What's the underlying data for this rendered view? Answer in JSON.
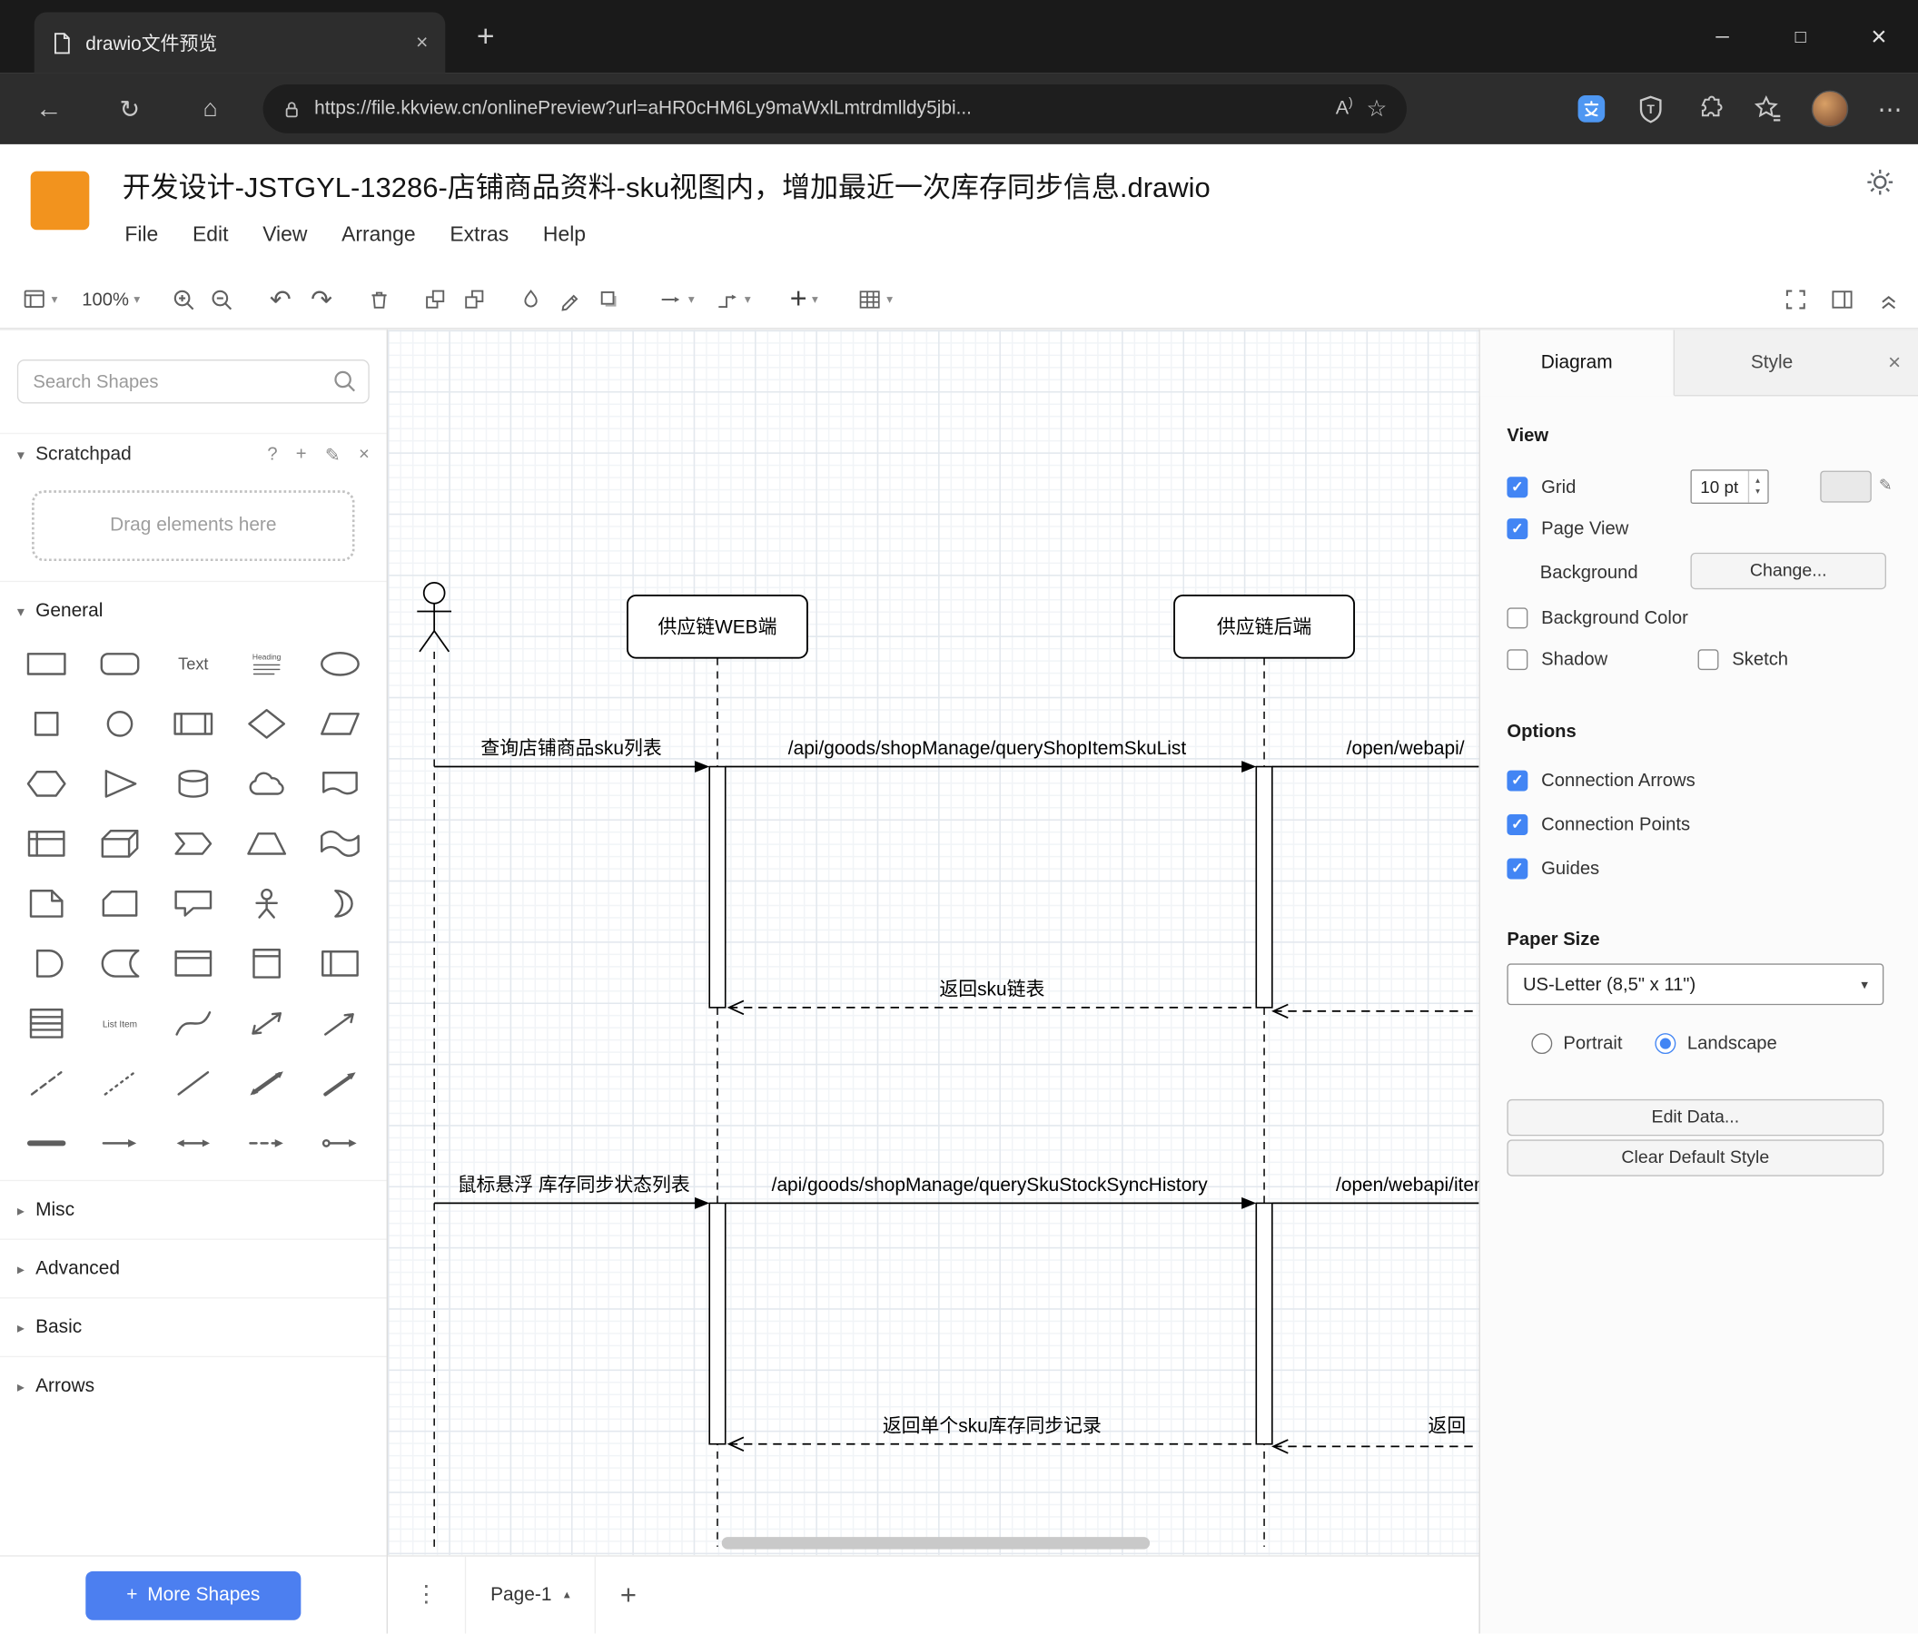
{
  "browser": {
    "tab_title": "drawio文件预览",
    "url": "https://file.kkview.cn/onlinePreview?url=aHR0cHM6Ly9maWxlLmtrdmlldy5jbi..."
  },
  "icons": {
    "back": "←",
    "refresh": "↻",
    "home": "⌂",
    "star": "☆",
    "read_aloud": "A",
    "minimize": "─",
    "maximize": "□",
    "close": "×",
    "new_tab": "+",
    "more_h": "⋯",
    "more_v": "⋮",
    "caret_down": "▾",
    "chevron_down": "▾",
    "chevron_right": "▸",
    "undo": "↶",
    "redo": "↷",
    "plus": "+",
    "question": "?",
    "pencil": "✎",
    "caret_up": "▴"
  },
  "header": {
    "title": "开发设计-JSTGYL-13286-店铺商品资料-sku视图内，增加最近一次库存同步信息.drawio",
    "menus": [
      "File",
      "Edit",
      "View",
      "Arrange",
      "Extras",
      "Help"
    ]
  },
  "toolbar": {
    "zoom": "100%"
  },
  "sidebar": {
    "search_placeholder": "Search Shapes",
    "scratchpad_label": "Scratchpad",
    "drop_hint": "Drag elements here",
    "sections": {
      "general": "General",
      "misc": "Misc",
      "advanced": "Advanced",
      "basic": "Basic",
      "arrows": "Arrows"
    },
    "more_shapes_label": "More Shapes",
    "shape_texts": {
      "text": "Text",
      "heading": "Heading",
      "list_item": "List Item"
    },
    "shape_names": [
      "rectangle",
      "rounded-rectangle",
      "text",
      "textbox",
      "ellipse",
      "square",
      "circle",
      "process",
      "diamond",
      "parallelogram",
      "hexagon",
      "triangle",
      "cylinder",
      "cloud",
      "document",
      "internal-storage",
      "cube",
      "step",
      "trapezoid",
      "tape",
      "note",
      "card",
      "callout",
      "actor",
      "or",
      "and",
      "data-storage",
      "container",
      "vertical-container",
      "horizontal-container",
      "list",
      "list-item",
      "curve",
      "bidirectional-arrow",
      "arrow",
      "dashed-line",
      "dotted-line",
      "line",
      "diagonal-double-arrow",
      "diagonal-arrow",
      "thick-line",
      "directional-connector",
      "bidirectional-connector",
      "dashed-connector",
      "endpoint-connector"
    ]
  },
  "canvas": {
    "participants": [
      "供应链WEB端",
      "供应链后端"
    ],
    "messages": {
      "m1": "查询店铺商品sku列表",
      "m2": "/api/goods/shopManage/queryShopItemSkuList",
      "m3": "/open/webapi/",
      "r1": "返回sku链表",
      "m4": "鼠标悬浮 库存同步状态列表",
      "m5": "/api/goods/shopManage/querySkuStockSyncHistory",
      "m6": "/open/webapi/item",
      "r2": "返回单个sku库存同步记录",
      "r3": "返回"
    }
  },
  "format_panel": {
    "tabs": {
      "diagram": "Diagram",
      "style": "Style"
    },
    "view": {
      "heading": "View",
      "grid": "Grid",
      "grid_size": "10 pt",
      "page_view": "Page View",
      "background": "Background",
      "change_button": "Change...",
      "background_color": "Background Color",
      "shadow": "Shadow",
      "sketch": "Sketch"
    },
    "options": {
      "heading": "Options",
      "connection_arrows": "Connection Arrows",
      "connection_points": "Connection Points",
      "guides": "Guides"
    },
    "paper": {
      "heading": "Paper Size",
      "size": "US-Letter (8,5\" x 11\")",
      "portrait": "Portrait",
      "landscape": "Landscape"
    },
    "buttons": {
      "edit_data": "Edit Data...",
      "clear_default_style": "Clear Default Style"
    }
  },
  "footer": {
    "page_tab": "Page-1"
  },
  "colors": {
    "logo_orange": "#f2931e",
    "more_shapes_blue": "#4c7ff0",
    "accent_blue": "#4285f4"
  }
}
